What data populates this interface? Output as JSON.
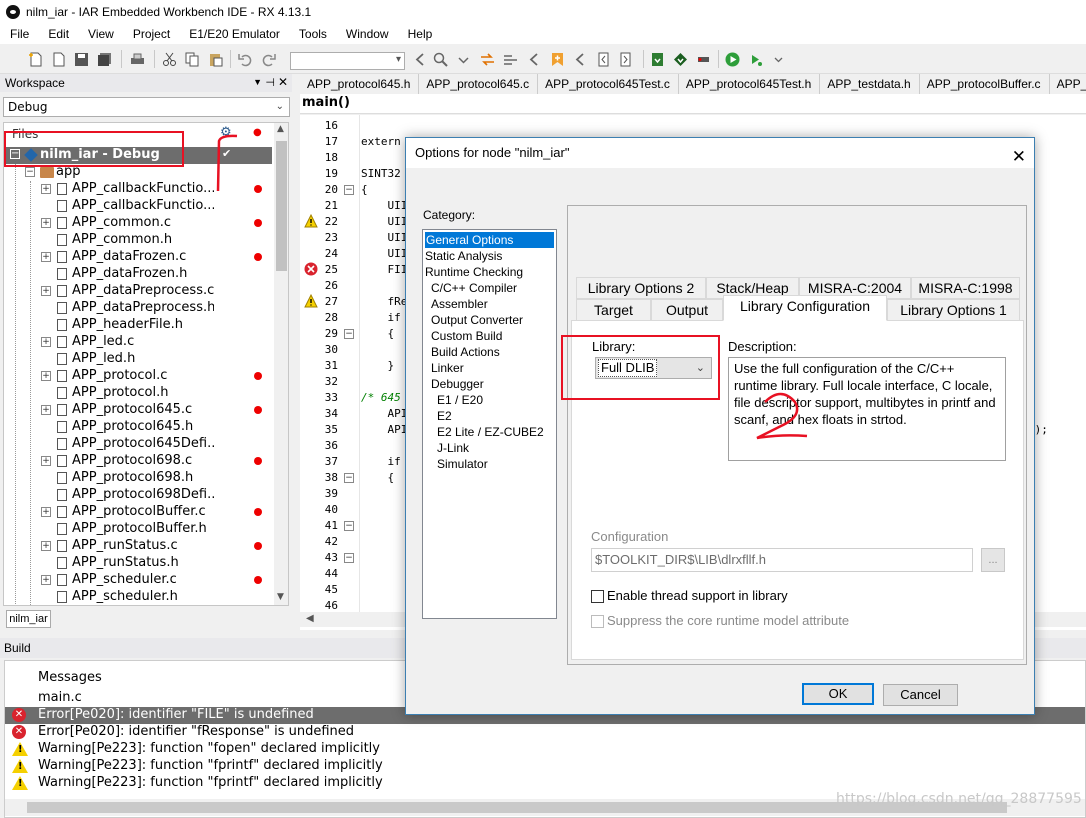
{
  "window": {
    "title": "nilm_iar - IAR Embedded Workbench IDE - RX 4.13.1"
  },
  "menu": [
    "File",
    "Edit",
    "View",
    "Project",
    "E1/E20 Emulator",
    "Tools",
    "Window",
    "Help"
  ],
  "workspace": {
    "title": "Workspace",
    "config": "Debug",
    "files_header": "Files",
    "root": "nilm_iar - Debug",
    "root_check": "✔",
    "folder": "app",
    "tab": "nilm_iar",
    "files": [
      {
        "name": "APP_callbackFunctio...",
        "type": "c",
        "bp": true
      },
      {
        "name": "APP_callbackFunctio...",
        "type": "h",
        "bp": false
      },
      {
        "name": "APP_common.c",
        "type": "c",
        "bp": true
      },
      {
        "name": "APP_common.h",
        "type": "h",
        "bp": false
      },
      {
        "name": "APP_dataFrozen.c",
        "type": "c",
        "bp": true
      },
      {
        "name": "APP_dataFrozen.h",
        "type": "h",
        "bp": false
      },
      {
        "name": "APP_dataPreprocess.c",
        "type": "c",
        "bp": false
      },
      {
        "name": "APP_dataPreprocess.h",
        "type": "h",
        "bp": false
      },
      {
        "name": "APP_headerFile.h",
        "type": "h",
        "bp": false
      },
      {
        "name": "APP_led.c",
        "type": "c",
        "bp": false
      },
      {
        "name": "APP_led.h",
        "type": "h",
        "bp": false
      },
      {
        "name": "APP_protocol.c",
        "type": "c",
        "bp": true
      },
      {
        "name": "APP_protocol.h",
        "type": "h",
        "bp": false
      },
      {
        "name": "APP_protocol645.c",
        "type": "c",
        "bp": true
      },
      {
        "name": "APP_protocol645.h",
        "type": "h",
        "bp": false
      },
      {
        "name": "APP_protocol645Defi...",
        "type": "h",
        "bp": false
      },
      {
        "name": "APP_protocol698.c",
        "type": "c",
        "bp": true
      },
      {
        "name": "APP_protocol698.h",
        "type": "h",
        "bp": false
      },
      {
        "name": "APP_protocol698Defi...",
        "type": "h",
        "bp": false
      },
      {
        "name": "APP_protocolBuffer.c",
        "type": "c",
        "bp": true
      },
      {
        "name": "APP_protocolBuffer.h",
        "type": "h",
        "bp": false
      },
      {
        "name": "APP_runStatus.c",
        "type": "c",
        "bp": true
      },
      {
        "name": "APP_runStatus.h",
        "type": "h",
        "bp": false
      },
      {
        "name": "APP_scheduler.c",
        "type": "c",
        "bp": true
      },
      {
        "name": "APP_scheduler.h",
        "type": "h",
        "bp": false
      }
    ]
  },
  "editor": {
    "tabs": [
      "APP_protocol645.h",
      "APP_protocol645.c",
      "APP_protocol645Test.c",
      "APP_protocol645Test.h",
      "APP_testdata.h",
      "APP_protocolBuffer.c",
      "APP_protocolBuffer.h"
    ],
    "function": "main()",
    "lines": [
      {
        "n": "16",
        "code": "",
        "icon": "",
        "fold": ""
      },
      {
        "n": "17",
        "code": "extern",
        "icon": "",
        "fold": ""
      },
      {
        "n": "18",
        "code": "",
        "icon": "",
        "fold": ""
      },
      {
        "n": "19",
        "code": "SINT32",
        "icon": "",
        "fold": ""
      },
      {
        "n": "20",
        "code": "{",
        "icon": "",
        "fold": "−"
      },
      {
        "n": "21",
        "code": "    UII",
        "icon": "",
        "fold": ""
      },
      {
        "n": "22",
        "code": "    UII",
        "icon": "warn",
        "fold": ""
      },
      {
        "n": "23",
        "code": "    UII",
        "icon": "",
        "fold": ""
      },
      {
        "n": "24",
        "code": "    UII",
        "icon": "",
        "fold": ""
      },
      {
        "n": "25",
        "code": "    FII",
        "icon": "err",
        "fold": ""
      },
      {
        "n": "26",
        "code": "",
        "icon": "",
        "fold": ""
      },
      {
        "n": "27",
        "code": "    fRe",
        "icon": "warn",
        "fold": ""
      },
      {
        "n": "28",
        "code": "    if",
        "icon": "",
        "fold": ""
      },
      {
        "n": "29",
        "code": "    {",
        "icon": "",
        "fold": "−"
      },
      {
        "n": "30",
        "code": "",
        "icon": "",
        "fold": ""
      },
      {
        "n": "31",
        "code": "    }",
        "icon": "",
        "fold": ""
      },
      {
        "n": "32",
        "code": "",
        "icon": "",
        "fold": ""
      },
      {
        "n": "33",
        "code": "/* 645",
        "icon": "",
        "fold": "",
        "comment": true
      },
      {
        "n": "34",
        "code": "    API",
        "icon": "",
        "fold": ""
      },
      {
        "n": "35",
        "code": "    API",
        "icon": "",
        "fold": ""
      },
      {
        "n": "36",
        "code": "",
        "icon": "",
        "fold": ""
      },
      {
        "n": "37",
        "code": "    if",
        "icon": "",
        "fold": ""
      },
      {
        "n": "38",
        "code": "    {",
        "icon": "",
        "fold": "−"
      },
      {
        "n": "39",
        "code": "",
        "icon": "",
        "fold": ""
      },
      {
        "n": "40",
        "code": "",
        "icon": "",
        "fold": ""
      },
      {
        "n": "41",
        "code": "",
        "icon": "",
        "fold": "−"
      },
      {
        "n": "42",
        "code": "",
        "icon": "",
        "fold": ""
      },
      {
        "n": "43",
        "code": "",
        "icon": "",
        "fold": "−"
      },
      {
        "n": "44",
        "code": "",
        "icon": "",
        "fold": ""
      },
      {
        "n": "45",
        "code": "",
        "icon": "",
        "fold": ""
      },
      {
        "n": "46",
        "code": "",
        "icon": "",
        "fold": ""
      }
    ],
    "line35_tail": "A);"
  },
  "build": {
    "title": "Build",
    "header": "Messages",
    "messages": [
      {
        "kind": "file",
        "text": "main.c"
      },
      {
        "kind": "err",
        "text": "Error[Pe020]: identifier \"FILE\" is undefined",
        "selected": true
      },
      {
        "kind": "err",
        "text": "Error[Pe020]: identifier \"fResponse\" is undefined"
      },
      {
        "kind": "warn",
        "text": "Warning[Pe223]: function \"fopen\" declared implicitly"
      },
      {
        "kind": "warn",
        "text": "Warning[Pe223]: function \"fprintf\" declared implicitly"
      },
      {
        "kind": "warn",
        "text": "Warning[Pe223]: function \"fprintf\" declared implicitly"
      }
    ]
  },
  "watermark": "https://blog.csdn.net/qq_28877595",
  "dialog": {
    "title": "Options for node \"nilm_iar\"",
    "close": "✕",
    "category_label": "Category:",
    "categories": [
      {
        "label": "General Options",
        "indent": 0,
        "selected": true
      },
      {
        "label": "Static Analysis",
        "indent": 0
      },
      {
        "label": "Runtime Checking",
        "indent": 0
      },
      {
        "label": "C/C++ Compiler",
        "indent": 1
      },
      {
        "label": "Assembler",
        "indent": 1
      },
      {
        "label": "Output Converter",
        "indent": 1
      },
      {
        "label": "Custom Build",
        "indent": 1
      },
      {
        "label": "Build Actions",
        "indent": 1
      },
      {
        "label": "Linker",
        "indent": 1
      },
      {
        "label": "Debugger",
        "indent": 1
      },
      {
        "label": "E1 / E20",
        "indent": 2
      },
      {
        "label": "E2",
        "indent": 2
      },
      {
        "label": "E2 Lite / EZ-CUBE2",
        "indent": 2
      },
      {
        "label": "J-Link",
        "indent": 2
      },
      {
        "label": "Simulator",
        "indent": 2
      }
    ],
    "tabs_top": [
      "Library Options 2",
      "Stack/Heap",
      "MISRA-C:2004",
      "MISRA-C:1998"
    ],
    "tabs_bottom": [
      "Target",
      "Output",
      "Library Configuration",
      "Library Options 1"
    ],
    "library_label": "Library:",
    "library_value": "Full DLIB",
    "description_label": "Description:",
    "description": "Use the full configuration of the C/C++ runtime library. Full locale interface, C locale, file descriptor support, multibytes in printf and scanf, and hex floats in strtod.",
    "configuration_label": "Configuration",
    "configuration_value": "$TOOLKIT_DIR$\\LIB\\dlrxfllf.h",
    "browse": "...",
    "thread_support": "Enable thread support in library",
    "suppress_core": "Suppress the core runtime model attribute",
    "ok": "OK",
    "cancel": "Cancel"
  },
  "annotation": {
    "number": "2"
  },
  "colors": {
    "selection": "#0078d7",
    "annotation": "#e81123",
    "tree_selected": "#6d6d6d"
  }
}
